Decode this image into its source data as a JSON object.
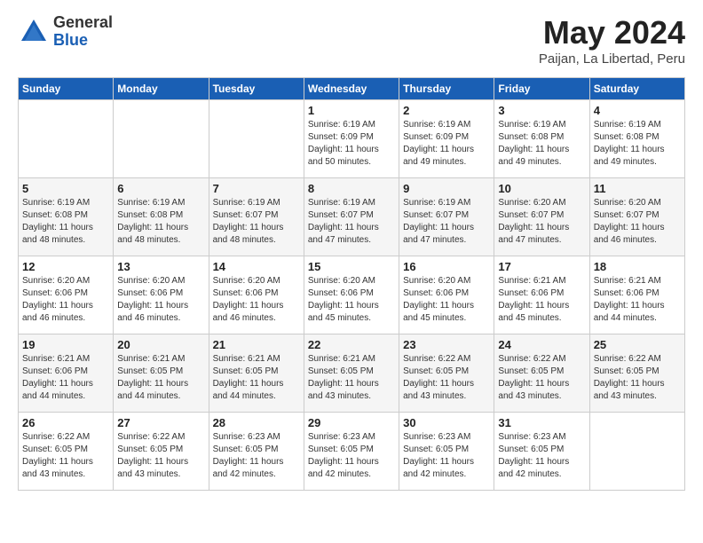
{
  "header": {
    "logo_general": "General",
    "logo_blue": "Blue",
    "title": "May 2024",
    "subtitle": "Paijan, La Libertad, Peru"
  },
  "days_of_week": [
    "Sunday",
    "Monday",
    "Tuesday",
    "Wednesday",
    "Thursday",
    "Friday",
    "Saturday"
  ],
  "weeks": [
    [
      {
        "day": "",
        "info": ""
      },
      {
        "day": "",
        "info": ""
      },
      {
        "day": "",
        "info": ""
      },
      {
        "day": "1",
        "info": "Sunrise: 6:19 AM\nSunset: 6:09 PM\nDaylight: 11 hours\nand 50 minutes."
      },
      {
        "day": "2",
        "info": "Sunrise: 6:19 AM\nSunset: 6:09 PM\nDaylight: 11 hours\nand 49 minutes."
      },
      {
        "day": "3",
        "info": "Sunrise: 6:19 AM\nSunset: 6:08 PM\nDaylight: 11 hours\nand 49 minutes."
      },
      {
        "day": "4",
        "info": "Sunrise: 6:19 AM\nSunset: 6:08 PM\nDaylight: 11 hours\nand 49 minutes."
      }
    ],
    [
      {
        "day": "5",
        "info": "Sunrise: 6:19 AM\nSunset: 6:08 PM\nDaylight: 11 hours\nand 48 minutes."
      },
      {
        "day": "6",
        "info": "Sunrise: 6:19 AM\nSunset: 6:08 PM\nDaylight: 11 hours\nand 48 minutes."
      },
      {
        "day": "7",
        "info": "Sunrise: 6:19 AM\nSunset: 6:07 PM\nDaylight: 11 hours\nand 48 minutes."
      },
      {
        "day": "8",
        "info": "Sunrise: 6:19 AM\nSunset: 6:07 PM\nDaylight: 11 hours\nand 47 minutes."
      },
      {
        "day": "9",
        "info": "Sunrise: 6:19 AM\nSunset: 6:07 PM\nDaylight: 11 hours\nand 47 minutes."
      },
      {
        "day": "10",
        "info": "Sunrise: 6:20 AM\nSunset: 6:07 PM\nDaylight: 11 hours\nand 47 minutes."
      },
      {
        "day": "11",
        "info": "Sunrise: 6:20 AM\nSunset: 6:07 PM\nDaylight: 11 hours\nand 46 minutes."
      }
    ],
    [
      {
        "day": "12",
        "info": "Sunrise: 6:20 AM\nSunset: 6:06 PM\nDaylight: 11 hours\nand 46 minutes."
      },
      {
        "day": "13",
        "info": "Sunrise: 6:20 AM\nSunset: 6:06 PM\nDaylight: 11 hours\nand 46 minutes."
      },
      {
        "day": "14",
        "info": "Sunrise: 6:20 AM\nSunset: 6:06 PM\nDaylight: 11 hours\nand 46 minutes."
      },
      {
        "day": "15",
        "info": "Sunrise: 6:20 AM\nSunset: 6:06 PM\nDaylight: 11 hours\nand 45 minutes."
      },
      {
        "day": "16",
        "info": "Sunrise: 6:20 AM\nSunset: 6:06 PM\nDaylight: 11 hours\nand 45 minutes."
      },
      {
        "day": "17",
        "info": "Sunrise: 6:21 AM\nSunset: 6:06 PM\nDaylight: 11 hours\nand 45 minutes."
      },
      {
        "day": "18",
        "info": "Sunrise: 6:21 AM\nSunset: 6:06 PM\nDaylight: 11 hours\nand 44 minutes."
      }
    ],
    [
      {
        "day": "19",
        "info": "Sunrise: 6:21 AM\nSunset: 6:06 PM\nDaylight: 11 hours\nand 44 minutes."
      },
      {
        "day": "20",
        "info": "Sunrise: 6:21 AM\nSunset: 6:05 PM\nDaylight: 11 hours\nand 44 minutes."
      },
      {
        "day": "21",
        "info": "Sunrise: 6:21 AM\nSunset: 6:05 PM\nDaylight: 11 hours\nand 44 minutes."
      },
      {
        "day": "22",
        "info": "Sunrise: 6:21 AM\nSunset: 6:05 PM\nDaylight: 11 hours\nand 43 minutes."
      },
      {
        "day": "23",
        "info": "Sunrise: 6:22 AM\nSunset: 6:05 PM\nDaylight: 11 hours\nand 43 minutes."
      },
      {
        "day": "24",
        "info": "Sunrise: 6:22 AM\nSunset: 6:05 PM\nDaylight: 11 hours\nand 43 minutes."
      },
      {
        "day": "25",
        "info": "Sunrise: 6:22 AM\nSunset: 6:05 PM\nDaylight: 11 hours\nand 43 minutes."
      }
    ],
    [
      {
        "day": "26",
        "info": "Sunrise: 6:22 AM\nSunset: 6:05 PM\nDaylight: 11 hours\nand 43 minutes."
      },
      {
        "day": "27",
        "info": "Sunrise: 6:22 AM\nSunset: 6:05 PM\nDaylight: 11 hours\nand 43 minutes."
      },
      {
        "day": "28",
        "info": "Sunrise: 6:23 AM\nSunset: 6:05 PM\nDaylight: 11 hours\nand 42 minutes."
      },
      {
        "day": "29",
        "info": "Sunrise: 6:23 AM\nSunset: 6:05 PM\nDaylight: 11 hours\nand 42 minutes."
      },
      {
        "day": "30",
        "info": "Sunrise: 6:23 AM\nSunset: 6:05 PM\nDaylight: 11 hours\nand 42 minutes."
      },
      {
        "day": "31",
        "info": "Sunrise: 6:23 AM\nSunset: 6:05 PM\nDaylight: 11 hours\nand 42 minutes."
      },
      {
        "day": "",
        "info": ""
      }
    ]
  ]
}
